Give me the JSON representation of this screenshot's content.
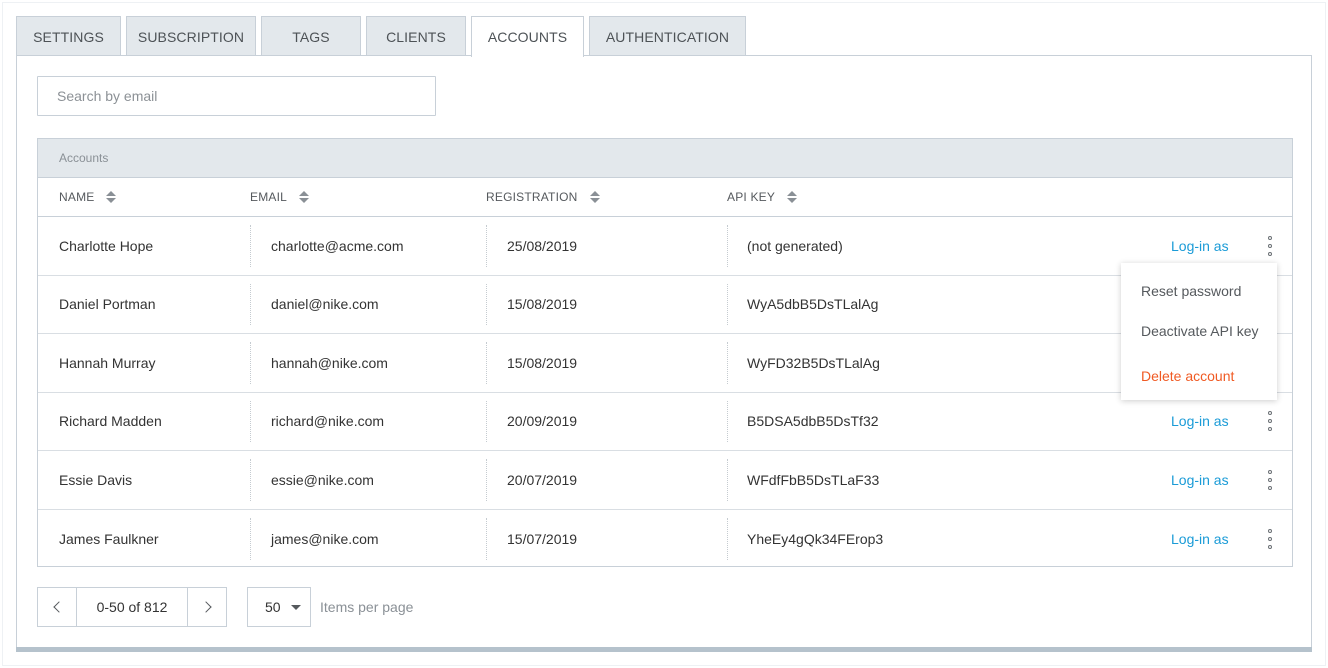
{
  "tabs": [
    {
      "label": "SETTINGS"
    },
    {
      "label": "SUBSCRIPTION"
    },
    {
      "label": "TAGS"
    },
    {
      "label": "CLIENTS"
    },
    {
      "label": "ACCOUNTS"
    },
    {
      "label": "AUTHENTICATION"
    }
  ],
  "active_tab": "ACCOUNTS",
  "search": {
    "placeholder": "Search by email",
    "value": ""
  },
  "table": {
    "caption": "Accounts",
    "columns": [
      {
        "label": "NAME"
      },
      {
        "label": "EMAIL"
      },
      {
        "label": "REGISTRATION"
      },
      {
        "label": "API KEY"
      }
    ],
    "action_label": "Log-in as",
    "rows": [
      {
        "name": "Charlotte Hope",
        "email": "charlotte@acme.com",
        "registration": "25/08/2019",
        "api_key": "(not generated)",
        "action": "Log-in as"
      },
      {
        "name": "Daniel Portman",
        "email": "daniel@nike.com",
        "registration": "15/08/2019",
        "api_key": "WyA5dbB5DsTLalAg",
        "action": ""
      },
      {
        "name": "Hannah Murray",
        "email": "hannah@nike.com",
        "registration": "15/08/2019",
        "api_key": "WyFD32B5DsTLalAg",
        "action": ""
      },
      {
        "name": "Richard Madden",
        "email": "richard@nike.com",
        "registration": "20/09/2019",
        "api_key": "B5DSA5dbB5DsTf32",
        "action": "Log-in as"
      },
      {
        "name": "Essie Davis",
        "email": "essie@nike.com",
        "registration": "20/07/2019",
        "api_key": "WFdfFbB5DsTLaF33",
        "action": "Log-in as"
      },
      {
        "name": "James Faulkner",
        "email": "james@nike.com",
        "registration": "15/07/2019",
        "api_key": "YheEy4gQk34FErop3",
        "action": "Log-in as"
      }
    ]
  },
  "menu": {
    "items": [
      {
        "label": "Reset password"
      },
      {
        "label": "Deactivate API key"
      },
      {
        "label": "Delete account"
      }
    ],
    "danger_color": "#f05a23"
  },
  "pagination": {
    "range": "0-50 of 812",
    "per_page": "50",
    "per_page_label": "Items per page"
  },
  "colors": {
    "link": "#1a9bd7",
    "header_bg": "#e3e8ec",
    "border": "#c8d0d8"
  }
}
